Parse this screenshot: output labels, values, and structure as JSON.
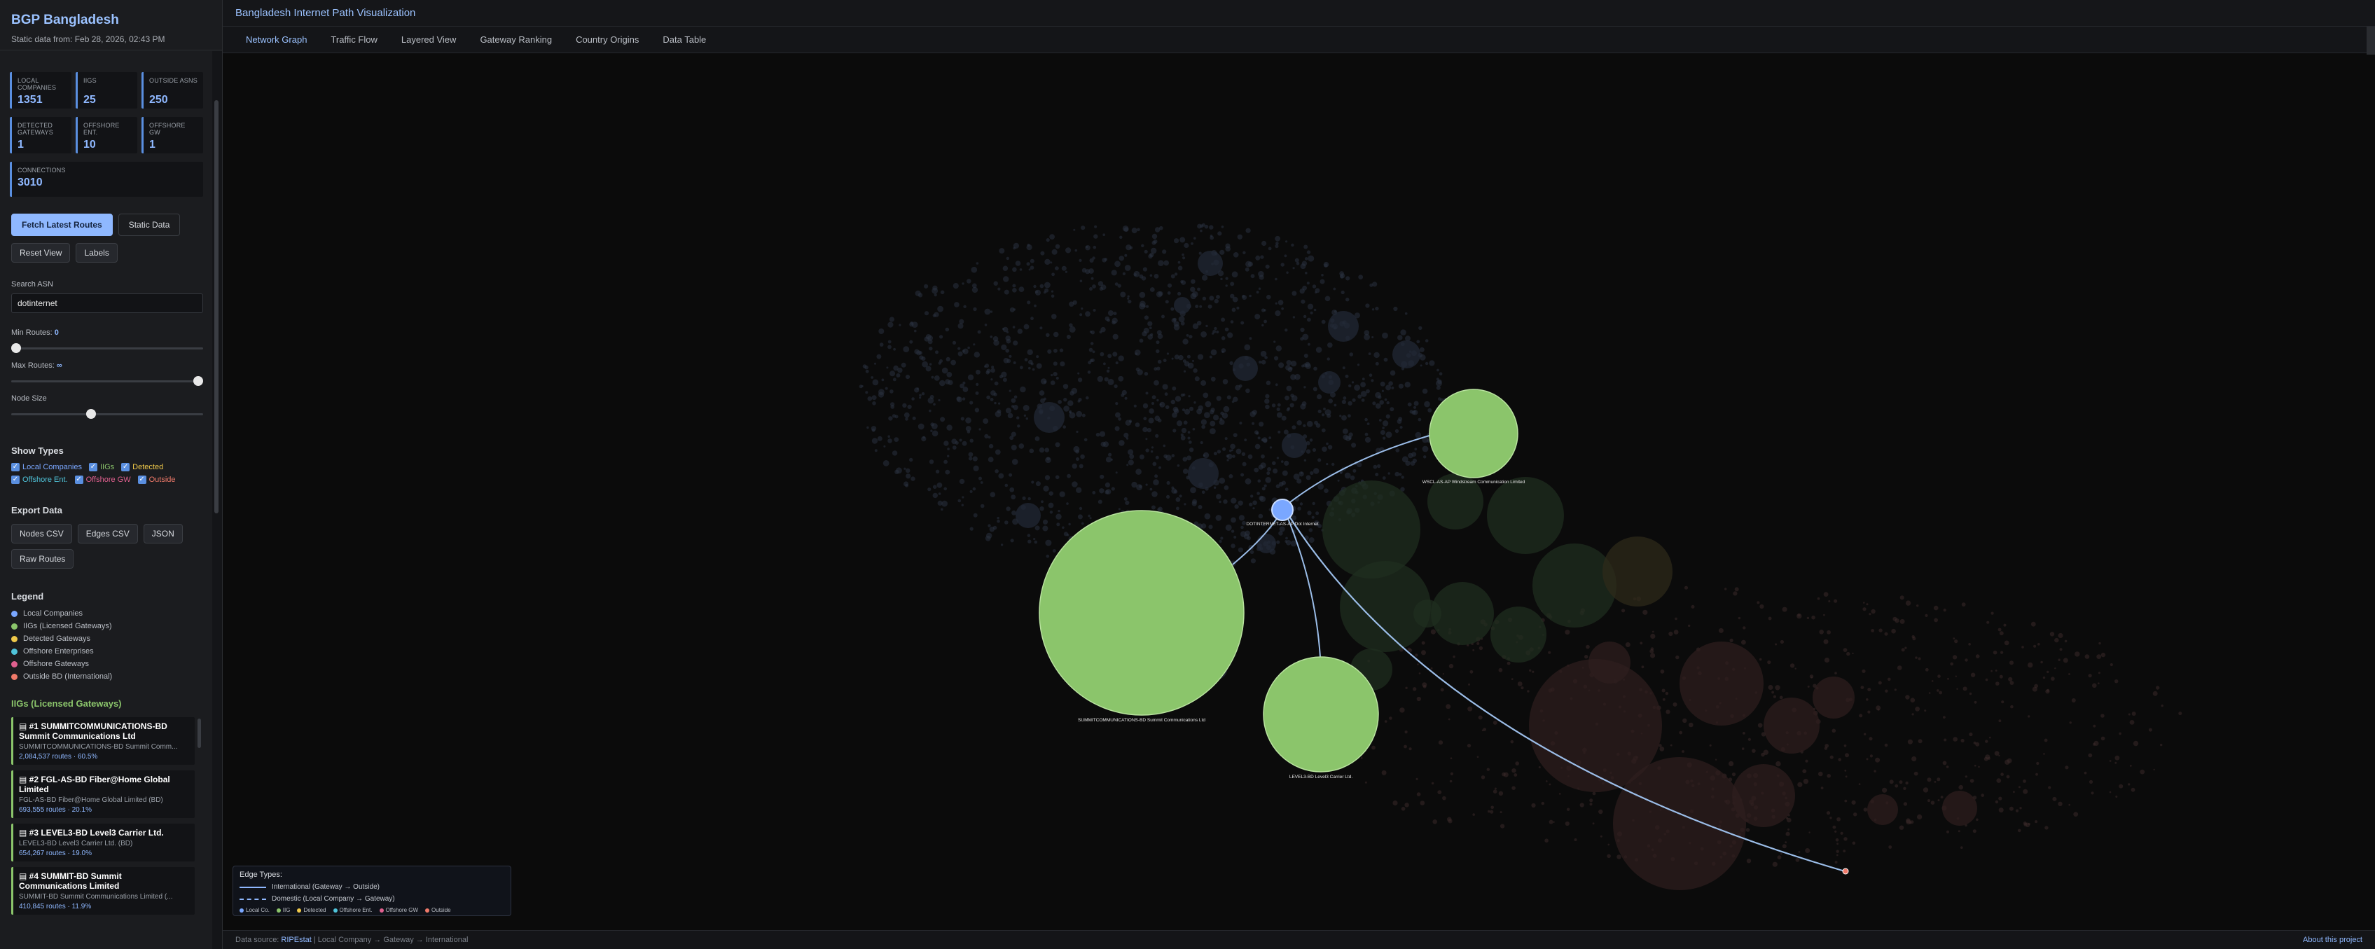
{
  "sidebar": {
    "title": "BGP Bangladesh",
    "subtitle": "Static data from: Feb 28, 2026, 02:43 PM",
    "stats": [
      {
        "label": "LOCAL COMPANIES",
        "value": "1351"
      },
      {
        "label": "IIGS",
        "value": "25"
      },
      {
        "label": "OUTSIDE ASNS",
        "value": "250"
      },
      {
        "label": "DETECTED GATEWAYS",
        "value": "1"
      },
      {
        "label": "OFFSHORE ENT.",
        "value": "10"
      },
      {
        "label": "OFFSHORE GW",
        "value": "1"
      }
    ],
    "connections": {
      "label": "CONNECTIONS",
      "value": "3010"
    },
    "buttons": {
      "fetch": "Fetch Latest Routes",
      "static": "Static Data",
      "reset": "Reset View",
      "labels": "Labels"
    },
    "search": {
      "label": "Search ASN",
      "value": "dotinternet"
    },
    "min_routes": {
      "label": "Min Routes:",
      "value": "0"
    },
    "max_routes": {
      "label": "Max Routes:",
      "value": "∞"
    },
    "node_size": {
      "label": "Node Size",
      "fraction": 0.41
    },
    "show_types": {
      "title": "Show Types",
      "items": [
        {
          "label": "Local Companies",
          "color": "#7aa7ff"
        },
        {
          "label": "IIGs",
          "color": "#8bc56b"
        },
        {
          "label": "Detected",
          "color": "#f0c94a"
        },
        {
          "label": "Offshore Ent.",
          "color": "#4fc3d9"
        },
        {
          "label": "Offshore GW",
          "color": "#e0608f"
        },
        {
          "label": "Outside",
          "color": "#f07a6a"
        }
      ]
    },
    "export": {
      "title": "Export Data",
      "buttons": [
        "Nodes CSV",
        "Edges CSV",
        "JSON",
        "Raw Routes"
      ]
    },
    "legend": {
      "title": "Legend",
      "items": [
        {
          "label": "Local Companies",
          "color": "#7aa7ff"
        },
        {
          "label": "IIGs (Licensed Gateways)",
          "color": "#8bc56b"
        },
        {
          "label": "Detected Gateways",
          "color": "#f0c94a"
        },
        {
          "label": "Offshore Enterprises",
          "color": "#4fc3d9"
        },
        {
          "label": "Offshore Gateways",
          "color": "#e0608f"
        },
        {
          "label": "Outside BD (International)",
          "color": "#f07a6a"
        }
      ]
    },
    "iig_list": {
      "title": "IIGs (Licensed Gateways)",
      "items": [
        {
          "title": "#1 SUMMITCOMMUNICATIONS-BD Summit Communications Ltd",
          "sub": "SUMMITCOMMUNICATIONS-BD Summit Comm...",
          "routes": "2,084,537 routes · 60.5%"
        },
        {
          "title": "#2 FGL-AS-BD Fiber@Home Global Limited",
          "sub": "FGL-AS-BD Fiber@Home Global Limited (BD)",
          "routes": "693,555 routes · 20.1%"
        },
        {
          "title": "#3 LEVEL3-BD Level3 Carrier Ltd.",
          "sub": "LEVEL3-BD Level3 Carrier Ltd. (BD)",
          "routes": "654,267 routes · 19.0%"
        },
        {
          "title": "#4 SUMMIT-BD Summit Communications Limited",
          "sub": "SUMMIT-BD Summit Communications Limited (...",
          "routes": "410,845 routes · 11.9%"
        }
      ]
    }
  },
  "main": {
    "title": "Bangladesh Internet Path Visualization",
    "tabs": [
      "Network Graph",
      "Traffic Flow",
      "Layered View",
      "Gateway Ranking",
      "Country Origins",
      "Data Table"
    ],
    "active_tab": 0
  },
  "graph": {
    "nodes": [
      {
        "label": "SUMMITCOMMUNICATIONS-BD Summit Communications Ltd",
        "type": "iig"
      },
      {
        "label": "WSCL-AS-AP Windstream Communication Limited",
        "type": "iig"
      },
      {
        "label": "LEVEL3-BD Level3 Carrier Ltd.",
        "type": "iig"
      },
      {
        "label": "DOTINTERNET-AS-AP Dot Internet",
        "type": "local"
      },
      {
        "label": "",
        "type": "outside"
      }
    ],
    "colors": {
      "iig": "#8bc56b",
      "local": "#7aa7ff",
      "edge": "#9bbde8",
      "outside": "#f07a6a"
    }
  },
  "edge_legend": {
    "title": "Edge Types:",
    "international": "International (Gateway → Outside)",
    "domestic": "Domestic (Local Company → Gateway)",
    "types": [
      {
        "label": "Local Co.",
        "color": "#7aa7ff"
      },
      {
        "label": "IIG",
        "color": "#8bc56b"
      },
      {
        "label": "Detected",
        "color": "#f0c94a"
      },
      {
        "label": "Offshore Ent.",
        "color": "#4fc3d9"
      },
      {
        "label": "Offshore GW",
        "color": "#e0608f"
      },
      {
        "label": "Outside",
        "color": "#f07a6a"
      }
    ]
  },
  "footer": {
    "prefix": "Data source: ",
    "source": "RIPEstat",
    "rest": " | Local Company → Gateway → International",
    "about": "About this project"
  }
}
